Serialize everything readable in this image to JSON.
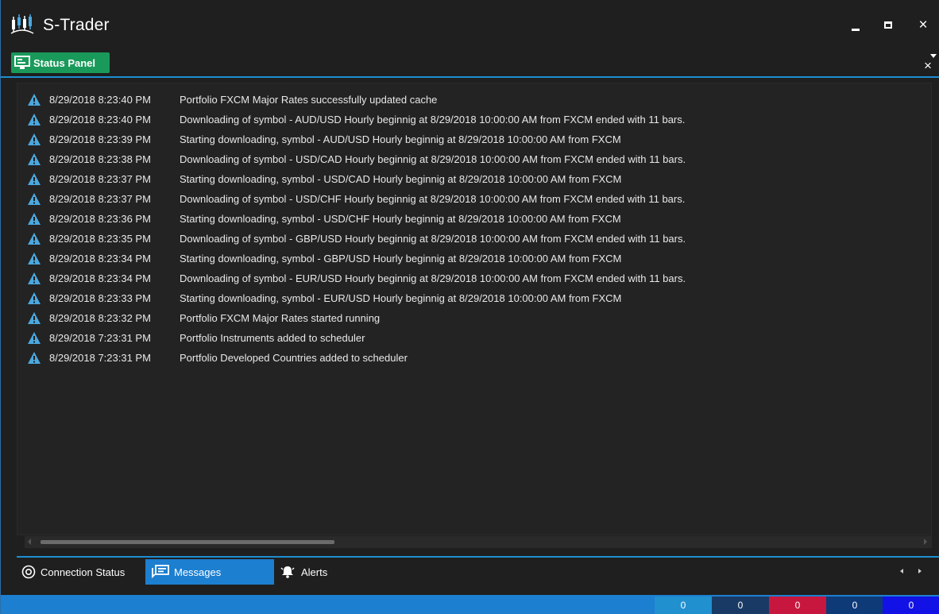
{
  "app": {
    "title": "S-Trader"
  },
  "window_controls": {
    "minimize": "minimize",
    "maximize": "maximize",
    "close": "×"
  },
  "panel": {
    "tab_label": "Status Panel",
    "close": "×"
  },
  "messages": [
    {
      "time": "8/29/2018 8:23:40 PM",
      "text": "Portfolio FXCM Major Rates successfully updated cache"
    },
    {
      "time": "8/29/2018 8:23:40 PM",
      "text": "Downloading of symbol - AUD/USD Hourly beginnig at 8/29/2018 10:00:00 AM from FXCM ended with 11 bars."
    },
    {
      "time": "8/29/2018 8:23:39 PM",
      "text": "Starting downloading, symbol - AUD/USD Hourly beginnig at 8/29/2018 10:00:00 AM from FXCM"
    },
    {
      "time": "8/29/2018 8:23:38 PM",
      "text": "Downloading of symbol - USD/CAD Hourly beginnig at 8/29/2018 10:00:00 AM from FXCM ended with 11 bars."
    },
    {
      "time": "8/29/2018 8:23:37 PM",
      "text": "Starting downloading, symbol - USD/CAD Hourly beginnig at 8/29/2018 10:00:00 AM from FXCM"
    },
    {
      "time": "8/29/2018 8:23:37 PM",
      "text": "Downloading of symbol - USD/CHF Hourly beginnig at 8/29/2018 10:00:00 AM from FXCM ended with 11 bars."
    },
    {
      "time": "8/29/2018 8:23:36 PM",
      "text": "Starting downloading, symbol - USD/CHF Hourly beginnig at 8/29/2018 10:00:00 AM from FXCM"
    },
    {
      "time": "8/29/2018 8:23:35 PM",
      "text": "Downloading of symbol - GBP/USD Hourly beginnig at 8/29/2018 10:00:00 AM from FXCM ended with 11 bars."
    },
    {
      "time": "8/29/2018 8:23:34 PM",
      "text": "Starting downloading, symbol - GBP/USD Hourly beginnig at 8/29/2018 10:00:00 AM from FXCM"
    },
    {
      "time": "8/29/2018 8:23:34 PM",
      "text": "Downloading of symbol - EUR/USD Hourly beginnig at 8/29/2018 10:00:00 AM from FXCM ended with 11 bars."
    },
    {
      "time": "8/29/2018 8:23:33 PM",
      "text": "Starting downloading, symbol - EUR/USD Hourly beginnig at 8/29/2018 10:00:00 AM from FXCM"
    },
    {
      "time": "8/29/2018 8:23:32 PM",
      "text": "Portfolio FXCM Major Rates started running"
    },
    {
      "time": "8/29/2018 7:23:31 PM",
      "text": "Portfolio Instruments added to scheduler"
    },
    {
      "time": "8/29/2018 7:23:31 PM",
      "text": "Portfolio Developed Countries added to scheduler"
    }
  ],
  "bottom_tabs": {
    "connection": "Connection Status",
    "messages": "Messages",
    "alerts": "Alerts"
  },
  "status_counters": [
    "0",
    "0",
    "0",
    "0",
    "0"
  ],
  "colors": {
    "accent": "#1c7fd0",
    "panel_tab": "#1a9a5a",
    "warning_icon": "#4aa8e0"
  }
}
